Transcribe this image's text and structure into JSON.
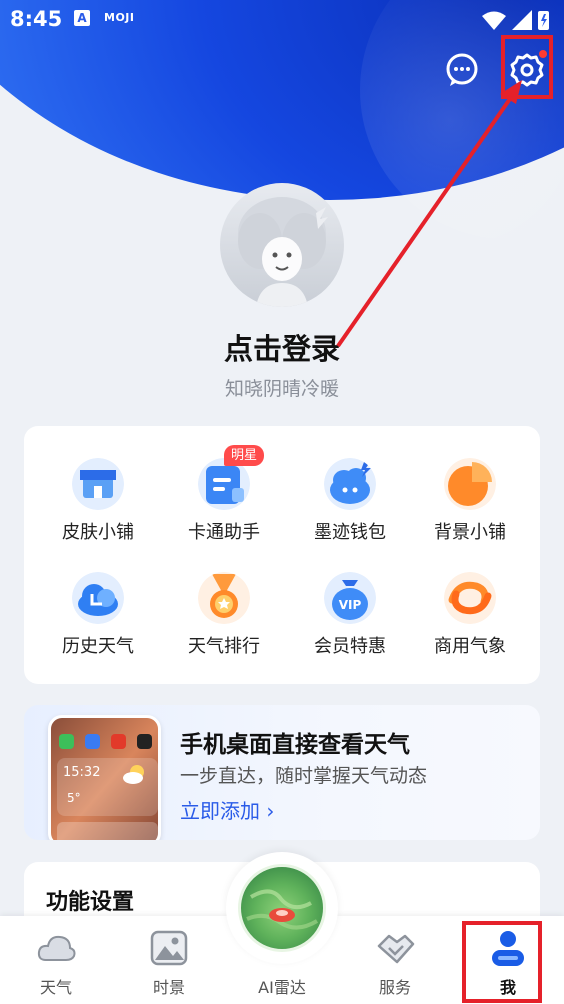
{
  "status_bar": {
    "time": "8:45",
    "app_badge": "A",
    "app_name": "MOJI"
  },
  "profile": {
    "login_title": "点击登录",
    "subtitle": "知晓阴晴冷暖"
  },
  "grid": {
    "badge": "明星",
    "items": [
      {
        "label": "皮肤小铺",
        "icon": "store-icon"
      },
      {
        "label": "卡通助手",
        "icon": "assistant-card-icon"
      },
      {
        "label": "墨迹钱包",
        "icon": "wallet-icon"
      },
      {
        "label": "背景小铺",
        "icon": "pie-chart-icon"
      },
      {
        "label": "历史天气",
        "icon": "history-cloud-icon"
      },
      {
        "label": "天气排行",
        "icon": "medal-icon"
      },
      {
        "label": "会员特惠",
        "icon": "vip-bag-icon"
      },
      {
        "label": "商用气象",
        "icon": "business-swirl-icon"
      }
    ]
  },
  "promo": {
    "title": "手机桌面直接查看天气",
    "subtitle": "一步直达，随时掌握天气动态",
    "link": "立即添加 ›",
    "widget_time": "15:32",
    "widget_temp": "5°"
  },
  "function_settings": {
    "title": "功能设置"
  },
  "tabbar": {
    "tabs": [
      {
        "label": "天气",
        "icon": "cloud-icon"
      },
      {
        "label": "时景",
        "icon": "image-icon"
      },
      {
        "label": "AI雷达",
        "icon": "radar-map-icon"
      },
      {
        "label": "服务",
        "icon": "handshake-icon"
      },
      {
        "label": "我",
        "icon": "person-icon"
      }
    ],
    "active": "我"
  },
  "colors": {
    "accent": "#2a5be8",
    "highlight": "#e5212a",
    "badge": "#ff4b4b"
  }
}
